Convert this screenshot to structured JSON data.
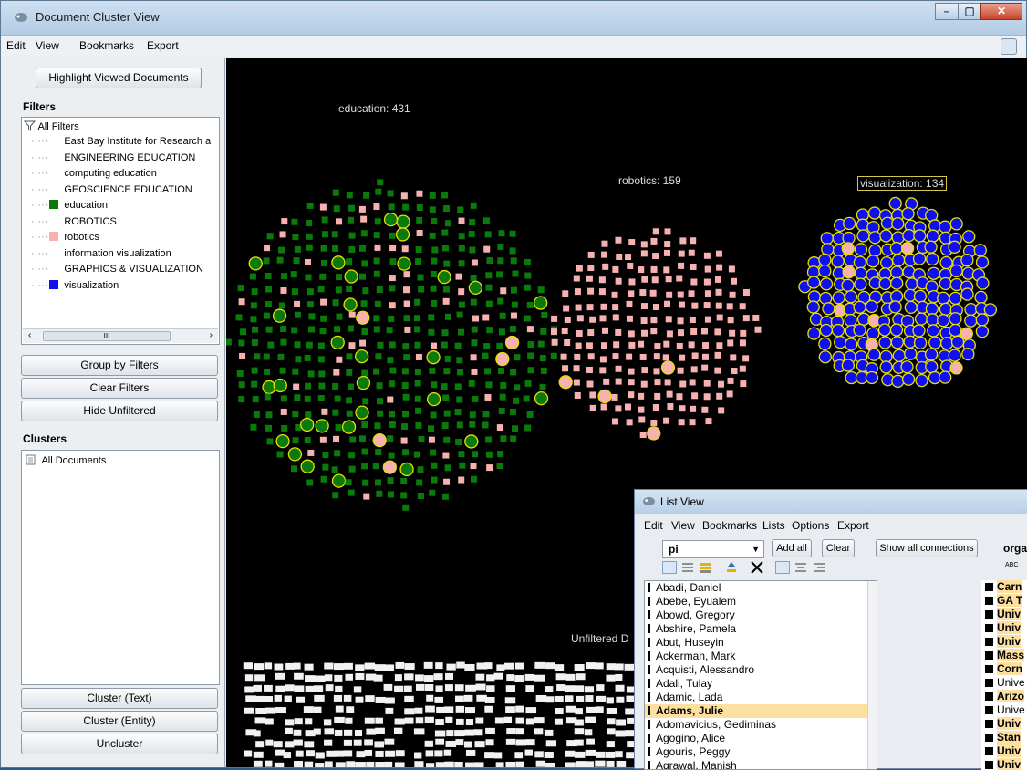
{
  "window": {
    "title": "Document Cluster View"
  },
  "menubar": [
    "Edit",
    "View",
    "Bookmarks",
    "Export"
  ],
  "sidebar": {
    "highlight_button": "Highlight Viewed Documents",
    "filters_heading": "Filters",
    "filters_root": "All Filters",
    "filters": [
      {
        "label": "East Bay Institute for Research a",
        "color": ""
      },
      {
        "label": "ENGINEERING EDUCATION",
        "color": ""
      },
      {
        "label": "computing education",
        "color": ""
      },
      {
        "label": "GEOSCIENCE EDUCATION",
        "color": ""
      },
      {
        "label": "education",
        "color": "#0a7a0a"
      },
      {
        "label": "ROBOTICS",
        "color": ""
      },
      {
        "label": "robotics",
        "color": "#f7b1b1"
      },
      {
        "label": "information visualization",
        "color": ""
      },
      {
        "label": "GRAPHICS & VISUALIZATION",
        "color": ""
      },
      {
        "label": "visualization",
        "color": "#1010ee"
      }
    ],
    "scroll_grip": "III",
    "group_by_filters": "Group by Filters",
    "clear_filters": "Clear Filters",
    "hide_unfiltered": "Hide Unfiltered",
    "clusters_heading": "Clusters",
    "clusters_root": "All Documents",
    "cluster_text": "Cluster (Text)",
    "cluster_entity": "Cluster (Entity)",
    "uncluster": "Uncluster"
  },
  "clusters": [
    {
      "label": "education: 431",
      "dominant_color": "#0a7a0a"
    },
    {
      "label": "robotics: 159",
      "dominant_color": "#f7b1b1"
    },
    {
      "label": "visualization: 134",
      "dominant_color": "#1010ee"
    }
  ],
  "unfiltered_label": "Unfiltered D",
  "list_view": {
    "title": "List View",
    "menu": [
      "Edit",
      "View",
      "Bookmarks",
      "Lists",
      "Options",
      "Export"
    ],
    "combo_value": "pi",
    "add_all": "Add all",
    "clear": "Clear",
    "show_all_connections": "Show all connections",
    "second_column_header": "orga",
    "abc_label": "ABC",
    "names": [
      "Abadi, Daniel",
      "Abebe, Eyualem",
      "Abowd, Gregory",
      "Abshire, Pamela",
      "Abut, Huseyin",
      "Ackerman, Mark",
      "Acquisti, Alessandro",
      "Adali, Tulay",
      "Adamic, Lada",
      "Adams, Julie",
      "Adomavicius, Gediminas",
      "Agogino, Alice",
      "Agouris, Peggy",
      "Agrawal, Manish"
    ],
    "selected_name": "Adams, Julie",
    "orgs": [
      {
        "text": "Carn",
        "hl": true
      },
      {
        "text": "GA T",
        "hl": true
      },
      {
        "text": "Univ",
        "hl": true
      },
      {
        "text": "Univ",
        "hl": true
      },
      {
        "text": "Univ",
        "hl": true
      },
      {
        "text": "Mass",
        "hl": true
      },
      {
        "text": "Corn",
        "hl": true
      },
      {
        "text": "Unive",
        "hl": false
      },
      {
        "text": "Arizo",
        "hl": true
      },
      {
        "text": "Unive",
        "hl": false
      },
      {
        "text": "Univ",
        "hl": true
      },
      {
        "text": "Stan",
        "hl": true
      },
      {
        "text": "Univ",
        "hl": true
      },
      {
        "text": "Univ",
        "hl": true
      }
    ]
  }
}
